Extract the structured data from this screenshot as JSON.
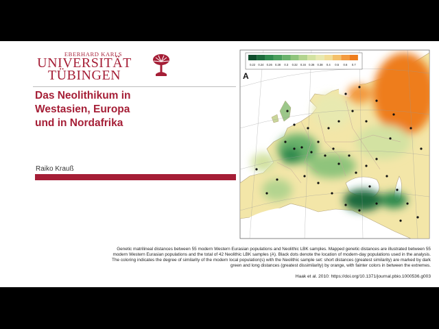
{
  "logo": {
    "top_line": "EBERHARD KARLS",
    "line1": "UNIVERSITÄT",
    "line2": "TÜBINGEN",
    "seal_icon": "palm-tree-seal-icon"
  },
  "title": {
    "line1": "Das Neolithikum in",
    "line2": "Westasien, Europa",
    "line3": "und in Nordafrika"
  },
  "author": "Raiko Krauß",
  "map": {
    "panel_label": "A",
    "legend_ticks": [
      "0.22",
      "0.24",
      "0.26",
      "0.28",
      "0.3",
      "0.32",
      "0.34",
      "0.36",
      "0.38",
      "0.4",
      "0.5",
      "0.6",
      "0.7"
    ],
    "legend_colors": [
      "#0f4d2c",
      "#1d6b3c",
      "#2f8a4d",
      "#4a9e5c",
      "#6ab26c",
      "#8fc47c",
      "#b3d48f",
      "#d3e2a2",
      "#e8e9b0",
      "#f1dd96",
      "#f4c06a",
      "#f39a3f",
      "#ee7d1d"
    ],
    "land_color": "#f3e6a8",
    "water_color": "#ffffff",
    "border_color": "#c3a59a",
    "dot_color": "#111111"
  },
  "caption": "Genetic matrilineal distances between 55 modern Western Eurasian populations and Neolithic LBK samples. Mapped genetic distances are illustrated between 55 modern Western Eurasian populations and the total of 42 Neolithic LBK samples (A). Black dots denote the location of modern-day populations used in the analysis. The coloring indicates the degree of similarity of the modern local population(s) with the Neolithic sample set: short distances (greatest similarity) are marked by dark green and long distances (greatest dissimilarity) by orange, with fainter colors in between the extremes.",
  "citation": "Haak et al. 2010: https://doi.org/10.1371/journal.pbio.1000536.g003"
}
